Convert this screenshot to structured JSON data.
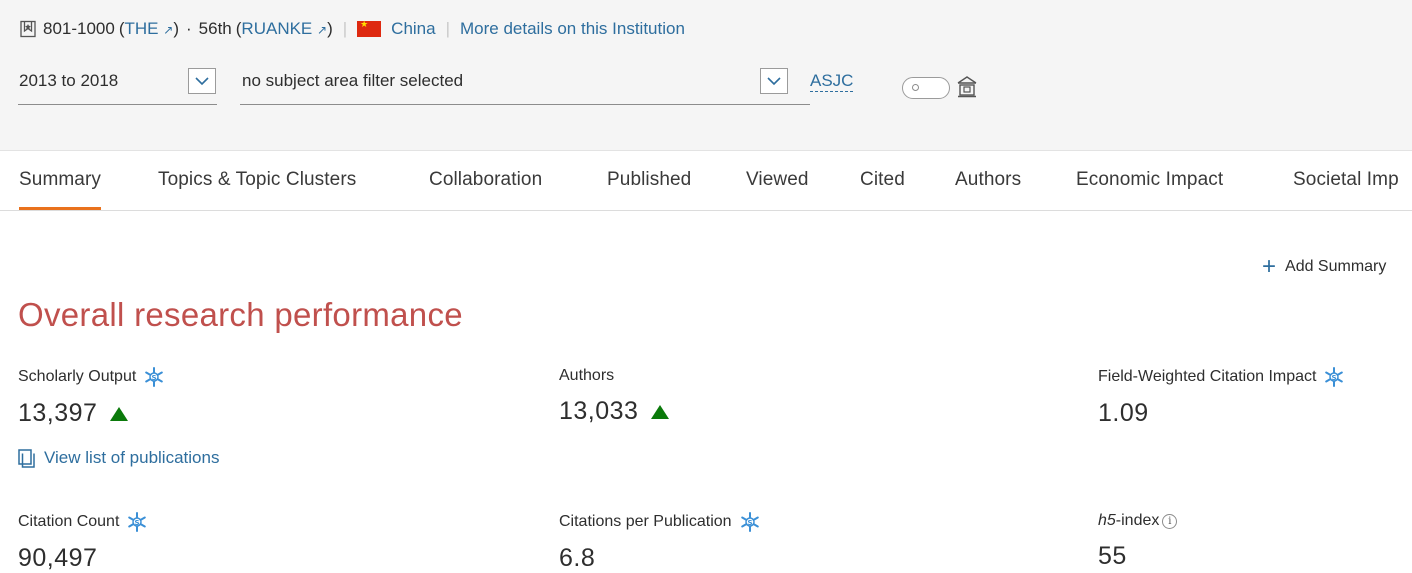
{
  "header": {
    "rank_the": "801-1000",
    "the_label": "THE",
    "the_arrow": "↗",
    "middot": "·",
    "rank_ruanke": "56th",
    "ruanke_label": "RUANKE",
    "ruanke_arrow": "↗",
    "country": "China",
    "more_details": "More details on this Institution"
  },
  "filters": {
    "year_range": "2013 to 2018",
    "subject_area": "no subject area filter selected",
    "asjc_link": "ASJC"
  },
  "tabs": [
    {
      "label": "Summary",
      "active": true
    },
    {
      "label": "Topics & Topic Clusters"
    },
    {
      "label": "Collaboration"
    },
    {
      "label": "Published"
    },
    {
      "label": "Viewed"
    },
    {
      "label": "Cited"
    },
    {
      "label": "Authors"
    },
    {
      "label": "Economic Impact"
    },
    {
      "label": "Societal Imp"
    }
  ],
  "actions": {
    "add_summary": "Add Summary"
  },
  "section": {
    "title": "Overall research performance"
  },
  "metrics": {
    "scholarly_output": {
      "label": "Scholarly Output",
      "value": "13,397",
      "trend": "up"
    },
    "authors": {
      "label": "Authors",
      "value": "13,033",
      "trend": "up"
    },
    "fwci": {
      "label": "Field-Weighted Citation Impact",
      "value": "1.09"
    },
    "citation_count": {
      "label": "Citation Count",
      "value": "90,497"
    },
    "citations_per_publication": {
      "label": "Citations per Publication",
      "value": "6.8"
    },
    "h5_index": {
      "label_italic": "h5",
      "label_rest": "-index",
      "value": "55"
    }
  },
  "links": {
    "view_list": "View list of publications"
  },
  "colors": {
    "link": "#2e6e9e",
    "title": "#c0504d",
    "accent_tab": "#e9711c",
    "trend_up": "#0b7a0b",
    "snowflake": "#3a8fd6"
  },
  "icons": [
    "bookmark-icon",
    "external-link-icon",
    "china-flag-icon",
    "chevron-down-icon",
    "toggle-switch",
    "institution-icon",
    "plus-icon",
    "snowball-metric-icon",
    "trend-up-icon",
    "info-icon",
    "publication-list-icon"
  ]
}
